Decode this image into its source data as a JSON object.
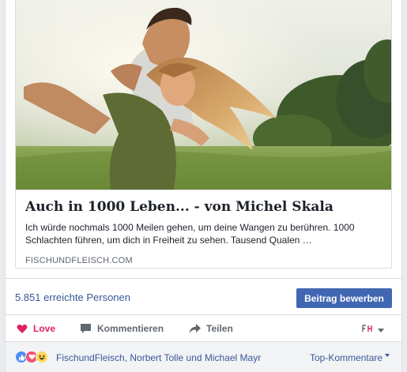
{
  "link_preview": {
    "image_icon": "couple-photo",
    "title": "Auch in 1000 Leben... - von Michel Skala",
    "description": "Ich würde nochmals 1000 Meilen gehen, um deine Wangen zu berühren. 1000 Schlachten führen, um dich in Freiheit zu sehen. Tausend Qualen …",
    "domain": "FISCHUNDFLEISCH.COM"
  },
  "reach": {
    "text": "5.851 erreichte Personen",
    "boost_label": "Beitrag bewerben"
  },
  "actions": {
    "love_label": "Love",
    "comment_label": "Kommentieren",
    "share_label": "Teilen",
    "love_icon": "heart-outline-icon",
    "comment_icon": "speech-bubble-icon",
    "share_icon": "share-arrow-icon",
    "audience_icon": "page-avatar-icon"
  },
  "reactions": {
    "icons": [
      "like-icon",
      "love-icon",
      "haha-icon"
    ],
    "names": "FischundFleisch, Norbert Tolle und Michael Mayr",
    "sort_label": "Top-Kommentare"
  },
  "colors": {
    "brand_blue": "#4267b2",
    "link_blue": "#385898",
    "love_red": "#e0245e"
  }
}
